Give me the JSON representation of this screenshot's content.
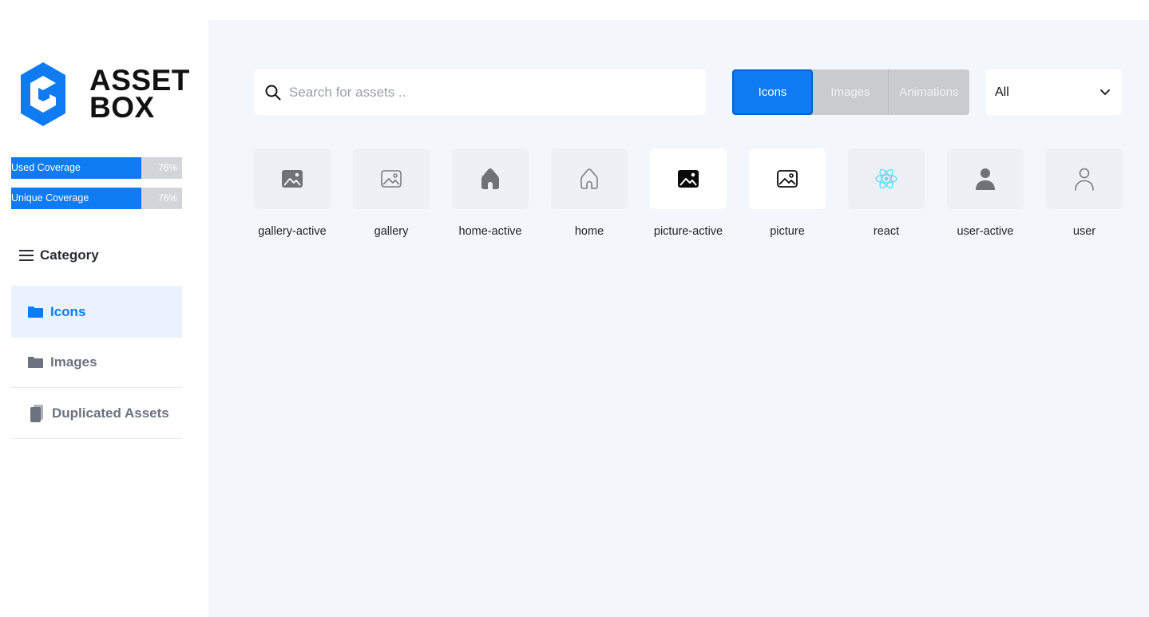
{
  "brand": {
    "line1": "ASSET",
    "line2": "BOX",
    "color": "#0f7bf2"
  },
  "coverage": [
    {
      "label": "Used Coverage",
      "value_text": "76%",
      "fill_fraction": 0.76
    },
    {
      "label": "Unique Coverage",
      "value_text": "76%",
      "fill_fraction": 0.76
    }
  ],
  "category": {
    "heading": "Category",
    "icon": "hamburger-icon"
  },
  "nav": [
    {
      "label": "Icons",
      "icon": "folder-icon",
      "active": true
    },
    {
      "label": "Images",
      "icon": "folder-icon",
      "active": false
    },
    {
      "label": "Duplicated Assets",
      "icon": "duplicate-icon",
      "active": false
    }
  ],
  "search": {
    "placeholder": "Search for assets ..",
    "value": "",
    "icon": "search-icon"
  },
  "type_tabs": [
    {
      "label": "Icons",
      "active": true
    },
    {
      "label": "Images",
      "active": false
    },
    {
      "label": "Animations",
      "active": false
    }
  ],
  "filter": {
    "selected": "All",
    "icon": "chevron-down-icon"
  },
  "assets": [
    {
      "name": "gallery-active",
      "icon": "gallery-filled-icon"
    },
    {
      "name": "gallery",
      "icon": "gallery-outline-icon"
    },
    {
      "name": "home-active",
      "icon": "home-filled-icon"
    },
    {
      "name": "home",
      "icon": "home-outline-icon"
    },
    {
      "name": "picture-active",
      "icon": "picture-filled-icon"
    },
    {
      "name": "picture",
      "icon": "picture-outline-icon"
    },
    {
      "name": "react",
      "icon": "react-icon"
    },
    {
      "name": "user-active",
      "icon": "user-filled-icon"
    },
    {
      "name": "user",
      "icon": "user-outline-icon"
    }
  ],
  "colors": {
    "accent": "#0f7bf2",
    "main_bg": "#f3f6fa",
    "active_nav_bg": "#eaf3fd",
    "react": "#61dafb"
  }
}
